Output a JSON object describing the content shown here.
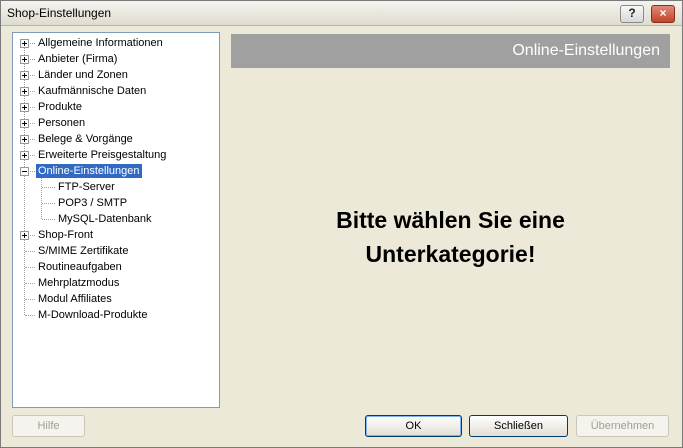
{
  "window": {
    "title": "Shop-Einstellungen",
    "help_glyph": "?",
    "close_glyph": "×"
  },
  "tree": {
    "items": [
      {
        "label": "Allgemeine Informationen",
        "expander": "plus",
        "level": 0
      },
      {
        "label": "Anbieter (Firma)",
        "expander": "plus",
        "level": 0
      },
      {
        "label": "Länder und Zonen",
        "expander": "plus",
        "level": 0
      },
      {
        "label": "Kaufmännische Daten",
        "expander": "plus",
        "level": 0
      },
      {
        "label": "Produkte",
        "expander": "plus",
        "level": 0
      },
      {
        "label": "Personen",
        "expander": "plus",
        "level": 0
      },
      {
        "label": "Belege & Vorgänge",
        "expander": "plus",
        "level": 0
      },
      {
        "label": "Erweiterte Preisgestaltung",
        "expander": "plus",
        "level": 0
      },
      {
        "label": "Online-Einstellungen",
        "expander": "minus",
        "level": 0,
        "selected": true
      },
      {
        "label": "FTP-Server",
        "expander": "none",
        "level": 1
      },
      {
        "label": "POP3 / SMTP",
        "expander": "none",
        "level": 1
      },
      {
        "label": "MySQL-Datenbank",
        "expander": "none",
        "level": 1
      },
      {
        "label": "Shop-Front",
        "expander": "plus",
        "level": 0
      },
      {
        "label": "S/MIME Zertifikate",
        "expander": "none",
        "level": 0
      },
      {
        "label": "Routineaufgaben",
        "expander": "none",
        "level": 0
      },
      {
        "label": "Mehrplatzmodus",
        "expander": "none",
        "level": 0
      },
      {
        "label": "Modul Affiliates",
        "expander": "none",
        "level": 0
      },
      {
        "label": "M-Download-Produkte",
        "expander": "none",
        "level": 0
      }
    ]
  },
  "panel": {
    "header": "Online-Einstellungen",
    "message_line1": "Bitte wählen Sie eine",
    "message_line2": "Unterkategorie!"
  },
  "buttons": {
    "help": "Hilfe",
    "ok": "OK",
    "close": "Schließen",
    "apply": "Übernehmen"
  },
  "colors": {
    "selection": "#316ac5",
    "header_bar": "#a0a0a0"
  }
}
